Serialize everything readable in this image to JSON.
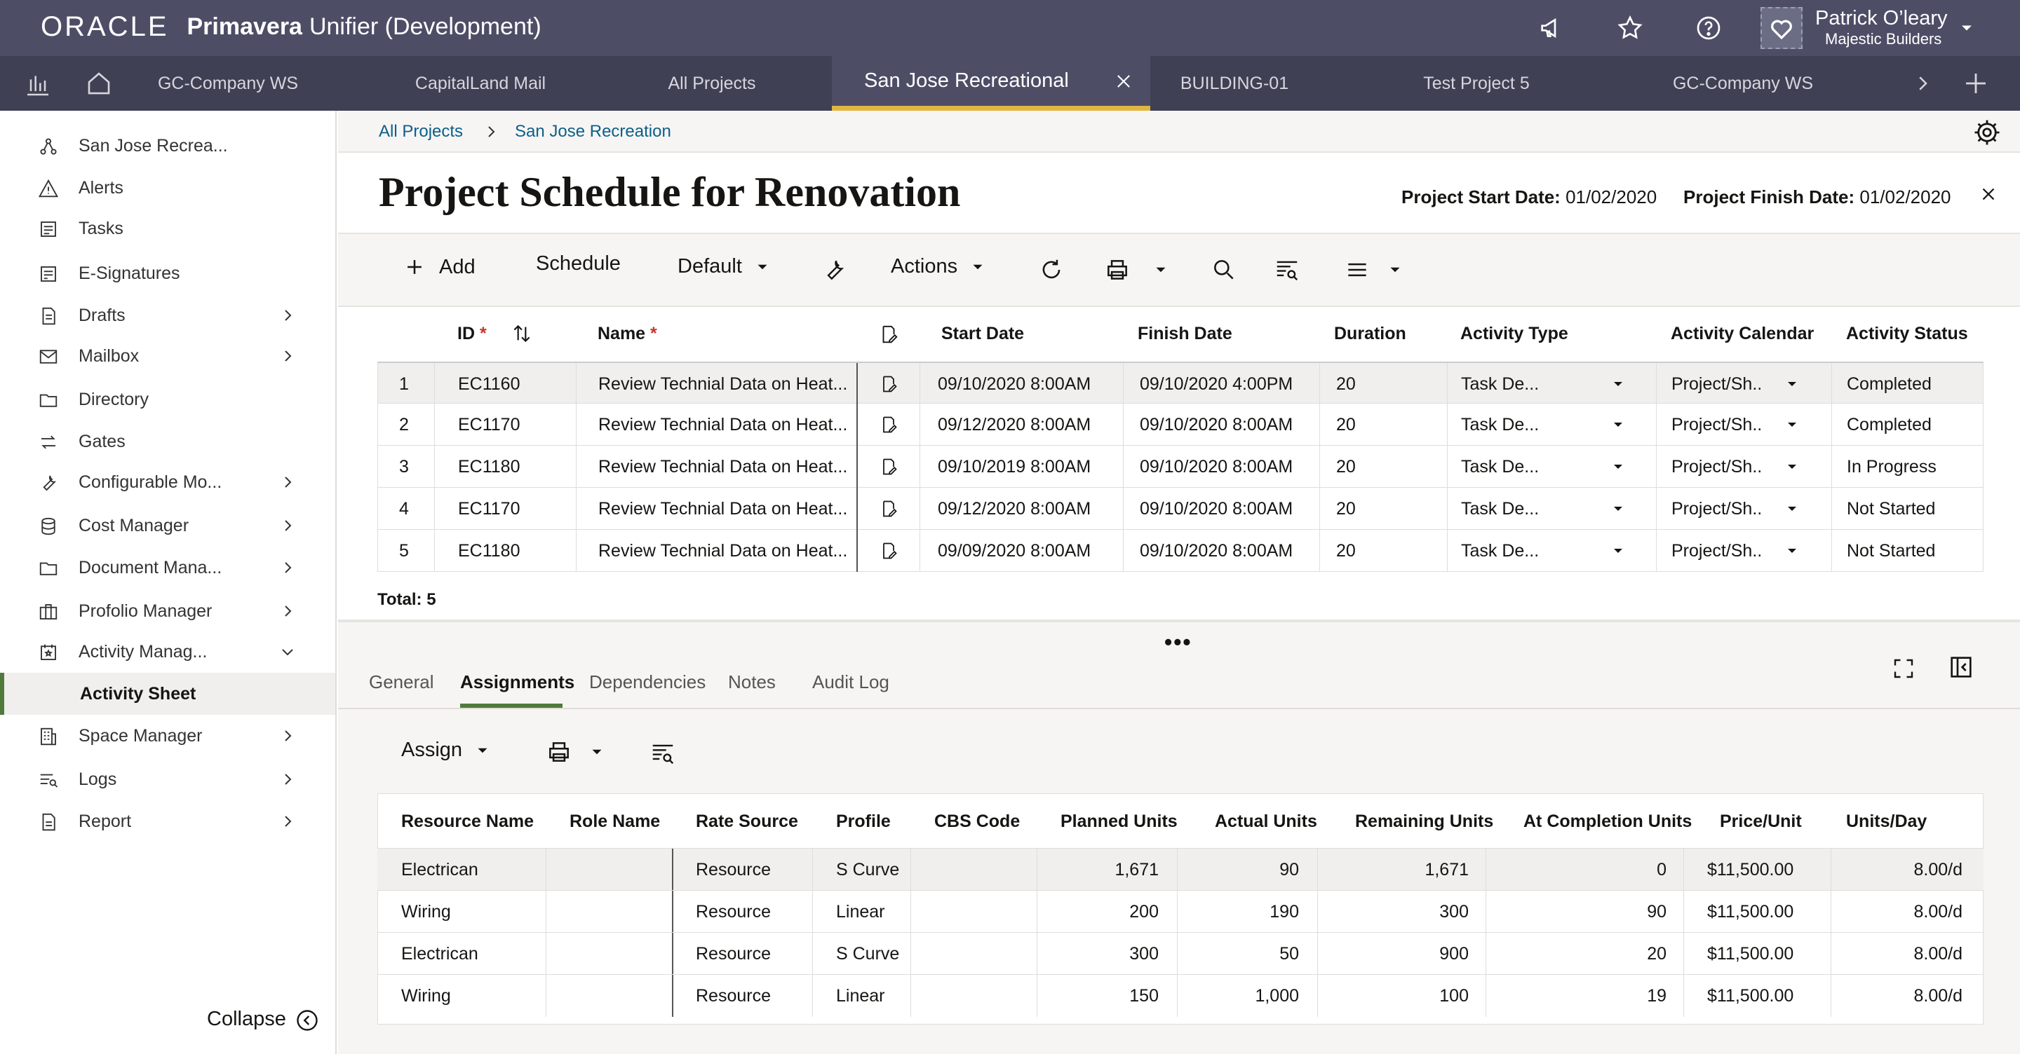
{
  "topbar": {
    "brand": "ORACLE",
    "app_name": "Primavera",
    "app_name_suffix": "Unifier (Development)",
    "user_name": "Patrick O’leary",
    "user_org": "Majestic Builders",
    "icons": [
      "megaphone-icon",
      "star-icon",
      "help-icon",
      "chevron-down-icon"
    ]
  },
  "project_tabs": [
    {
      "label": "GC-Company WS"
    },
    {
      "label": "CapitalLand Mail"
    },
    {
      "label": "All Projects"
    },
    {
      "label": "San Jose Recreational",
      "active": true
    },
    {
      "label": "BUILDING-01"
    },
    {
      "label": "Test Project 5"
    },
    {
      "label": "GC-Company WS"
    }
  ],
  "sidebar": {
    "items": [
      {
        "label": "San Jose Recrea...",
        "icon": "project-icon"
      },
      {
        "label": "Alerts",
        "icon": "alert-icon"
      },
      {
        "label": "Tasks",
        "icon": "tasks-icon"
      },
      {
        "label": "E-Signatures",
        "icon": "esignature-icon"
      },
      {
        "label": "Drafts",
        "icon": "drafts-icon",
        "has_children": true
      },
      {
        "label": "Mailbox",
        "icon": "mail-icon",
        "has_children": true
      },
      {
        "label": "Directory",
        "icon": "folder-icon"
      },
      {
        "label": "Gates",
        "icon": "gates-icon"
      },
      {
        "label": "Configurable Mo...",
        "icon": "wrench-icon",
        "has_children": true
      },
      {
        "label": "Cost Manager",
        "icon": "database-icon",
        "has_children": true
      },
      {
        "label": "Document Mana...",
        "icon": "folder-icon",
        "has_children": true
      },
      {
        "label": "Profolio Manager",
        "icon": "briefcase-icon",
        "has_children": true
      },
      {
        "label": "Activity Manag...",
        "icon": "calendar-icon",
        "expanded": true
      },
      {
        "label": "Activity Sheet",
        "active": true
      },
      {
        "label": "Space Manager",
        "icon": "building-icon",
        "has_children": true
      },
      {
        "label": "Logs",
        "icon": "logs-icon",
        "has_children": true
      },
      {
        "label": "Report",
        "icon": "report-icon",
        "has_children": true
      }
    ],
    "collapse_label": "Collapse"
  },
  "breadcrumb": {
    "root": "All Projects",
    "current": "San Jose Recreation"
  },
  "page": {
    "title": "Project Schedule for Renovation",
    "start_label": "Project Start Date:",
    "start_value": "01/02/2020",
    "finish_label": "Project Finish Date:",
    "finish_value": "01/02/2020"
  },
  "toolbar": {
    "add": "Add",
    "schedule": "Schedule",
    "view": "Default",
    "actions": "Actions"
  },
  "grid": {
    "columns": [
      "ID",
      "Name",
      "Start Date",
      "Finish Date",
      "Duration",
      "Activity Type",
      "Activity Calendar",
      "Activity Status"
    ],
    "required_mark": "*",
    "rows": [
      {
        "n": "1",
        "id": "EC1160",
        "name": "Review Technial Data on Heat...",
        "start": "09/10/2020 8:00AM",
        "finish": "09/10/2020 4:00PM",
        "duration": "20",
        "type": "Task De...",
        "calendar": "Project/Sh..",
        "status": "Completed"
      },
      {
        "n": "2",
        "id": "EC1170",
        "name": "Review Technial Data on Heat...",
        "start": "09/12/2020 8:00AM",
        "finish": "09/10/2020 8:00AM",
        "duration": "20",
        "type": "Task De...",
        "calendar": "Project/Sh..",
        "status": "Completed"
      },
      {
        "n": "3",
        "id": "EC1180",
        "name": "Review Technial Data on Heat...",
        "start": "09/10/2019 8:00AM",
        "finish": "09/10/2020 8:00AM",
        "duration": "20",
        "type": "Task De...",
        "calendar": "Project/Sh..",
        "status": "In Progress"
      },
      {
        "n": "4",
        "id": "EC1170",
        "name": "Review Technial Data on Heat...",
        "start": "09/12/2020 8:00AM",
        "finish": "09/10/2020 8:00AM",
        "duration": "20",
        "type": "Task De...",
        "calendar": "Project/Sh..",
        "status": "Not Started"
      },
      {
        "n": "5",
        "id": "EC1180",
        "name": "Review Technial Data on Heat...",
        "start": "09/09/2020 8:00AM",
        "finish": "09/10/2020 8:00AM",
        "duration": "20",
        "type": "Task De...",
        "calendar": "Project/Sh..",
        "status": "Not Started"
      }
    ],
    "total_label": "Total: 5"
  },
  "detail": {
    "tabs": [
      {
        "label": "General"
      },
      {
        "label": "Assignments",
        "active": true
      },
      {
        "label": "Dependencies"
      },
      {
        "label": "Notes"
      },
      {
        "label": "Audit Log"
      }
    ],
    "assign_label": "Assign",
    "columns": [
      "Resource Name",
      "Role Name",
      "Rate Source",
      "Profile",
      "CBS Code",
      "Planned Units",
      "Actual Units",
      "Remaining Units",
      "At Completion Units",
      "Price/Unit",
      "Units/Day"
    ],
    "rows": [
      {
        "resource": "Electrican",
        "role": "",
        "rate": "Resource",
        "profile": "S Curve",
        "cbs": "",
        "planned": "1,671",
        "actual": "90",
        "remaining": "1,671",
        "completion": "0",
        "price": "$11,500.00",
        "per_day": "8.00/d"
      },
      {
        "resource": "Wiring",
        "role": "",
        "rate": "Resource",
        "profile": "Linear",
        "cbs": "",
        "planned": "200",
        "actual": "190",
        "remaining": "300",
        "completion": "90",
        "price": "$11,500.00",
        "per_day": "8.00/d"
      },
      {
        "resource": "Electrican",
        "role": "",
        "rate": "Resource",
        "profile": "S Curve",
        "cbs": "",
        "planned": "300",
        "actual": "50",
        "remaining": "900",
        "completion": "20",
        "price": "$11,500.00",
        "per_day": "8.00/d"
      },
      {
        "resource": "Wiring",
        "role": "",
        "rate": "Resource",
        "profile": "Linear",
        "cbs": "",
        "planned": "150",
        "actual": "1,000",
        "remaining": "100",
        "completion": "19",
        "price": "$11,500.00",
        "per_day": "8.00/d"
      }
    ]
  },
  "colors": {
    "topbar": "#4d4e66",
    "tabbar": "#3f4053",
    "active_tab_underline": "#e1b542",
    "accent": "#4f7a3a",
    "link": "#0b5f8a"
  }
}
